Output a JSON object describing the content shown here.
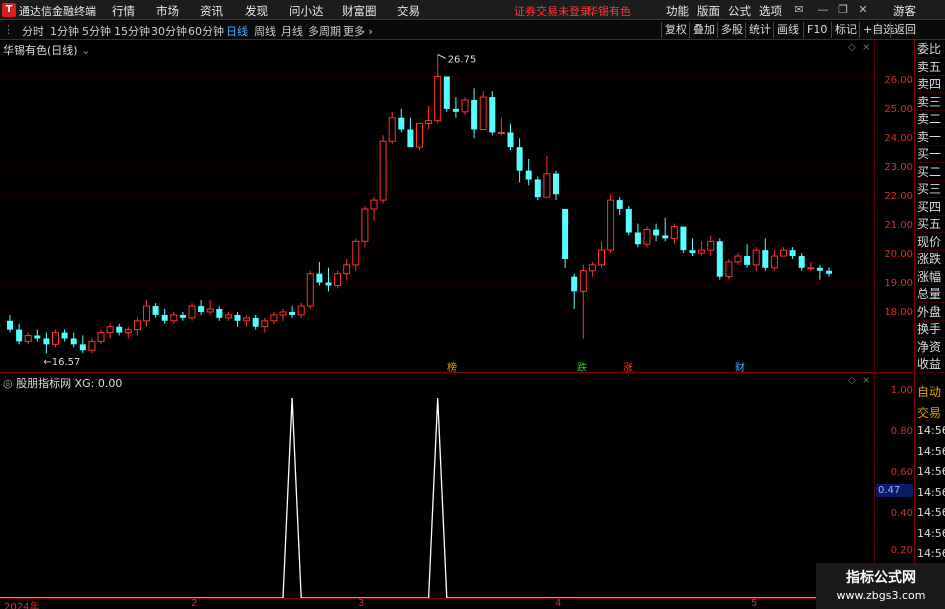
{
  "app": {
    "title": "通达信金融终端",
    "logo": "T"
  },
  "menu": [
    "行情",
    "市场",
    "资讯",
    "发现",
    "问小达",
    "财富圈",
    "交易"
  ],
  "notice": {
    "trade": "证券交易未登录",
    "stock": "华锡有色"
  },
  "right_menu": [
    "功能",
    "版面",
    "公式",
    "选项"
  ],
  "user": "游客",
  "period_tabs": [
    "分时",
    "1分钟",
    "5分钟",
    "15分钟",
    "30分钟",
    "60分钟",
    "日线",
    "周线",
    "月线",
    "多周期",
    "更多"
  ],
  "active_period": "日线",
  "right_buttons": [
    "复权",
    "叠加",
    "多股",
    "统计",
    "画线",
    "F10",
    "标记",
    "+自选",
    "返回"
  ],
  "stock_title": "华锡有色(日线)",
  "indicator_title": "股朋指标网 XG: 0.00",
  "price_axis": [
    "26.00",
    "25.00",
    "24.00",
    "23.00",
    "22.00",
    "21.00",
    "20.00",
    "19.00",
    "18.00"
  ],
  "ind_axis": [
    "1.00",
    "0.80",
    "0.60",
    "0.40",
    "0.20"
  ],
  "xg_current": "0.47",
  "price_high_label": "26.75",
  "price_low_label": "16.57",
  "event_tags": [
    {
      "text": "榜",
      "color": "#e0a000"
    },
    {
      "text": "跌",
      "color": "#22cc22"
    },
    {
      "text": "涨",
      "color": "#ff3333"
    },
    {
      "text": "财",
      "color": "#55aaff"
    }
  ],
  "side_panel": [
    "委比",
    "卖五",
    "卖四",
    "卖三",
    "卖二",
    "卖一",
    "买一",
    "买二",
    "买三",
    "买四",
    "买五",
    "现价",
    "涨跌",
    "涨幅",
    "总量",
    "外盘",
    "换手",
    "净资",
    "收益"
  ],
  "side_lower": [
    "自动",
    "交易",
    "14:56",
    "14:56",
    "14:56",
    "14:56",
    "14:56",
    "14:56",
    "14:56",
    "14:56",
    "14:56",
    "14:56"
  ],
  "x_axis": [
    "2024年",
    "2",
    "3",
    "4",
    "5"
  ],
  "watermark": {
    "line1": "指标公式网",
    "line2": "www.zbgs3.com"
  },
  "colors": {
    "up": "#ff3232",
    "down": "#54ffff",
    "axis": "#cc3333",
    "signal": "#ffffff"
  },
  "chart_data": {
    "type": "candlestick",
    "ylim": [
      16.3,
      26.9
    ],
    "candles": [
      [
        17.7,
        17.9,
        17.3,
        17.4
      ],
      [
        17.4,
        17.6,
        16.9,
        17.0
      ],
      [
        17.0,
        17.3,
        16.9,
        17.2
      ],
      [
        17.2,
        17.4,
        17.0,
        17.1
      ],
      [
        17.1,
        17.3,
        16.6,
        16.9
      ],
      [
        16.9,
        17.4,
        16.8,
        17.3
      ],
      [
        17.3,
        17.4,
        17.0,
        17.1
      ],
      [
        17.1,
        17.3,
        16.8,
        16.9
      ],
      [
        16.9,
        17.2,
        16.6,
        16.7
      ],
      [
        16.7,
        17.1,
        16.6,
        17.0
      ],
      [
        17.0,
        17.4,
        16.9,
        17.3
      ],
      [
        17.3,
        17.6,
        17.1,
        17.5
      ],
      [
        17.5,
        17.6,
        17.2,
        17.3
      ],
      [
        17.3,
        17.5,
        17.1,
        17.4
      ],
      [
        17.4,
        17.8,
        17.2,
        17.7
      ],
      [
        17.7,
        18.4,
        17.5,
        18.2
      ],
      [
        18.2,
        18.3,
        17.8,
        17.9
      ],
      [
        17.9,
        18.1,
        17.6,
        17.7
      ],
      [
        17.7,
        18.0,
        17.6,
        17.9
      ],
      [
        17.9,
        18.0,
        17.7,
        17.8
      ],
      [
        17.8,
        18.3,
        17.7,
        18.2
      ],
      [
        18.2,
        18.4,
        17.9,
        18.0
      ],
      [
        18.0,
        18.4,
        17.9,
        18.1
      ],
      [
        18.1,
        18.2,
        17.7,
        17.8
      ],
      [
        17.8,
        18.0,
        17.7,
        17.9
      ],
      [
        17.9,
        18.0,
        17.5,
        17.7
      ],
      [
        17.7,
        17.9,
        17.5,
        17.8
      ],
      [
        17.8,
        17.9,
        17.4,
        17.5
      ],
      [
        17.5,
        17.8,
        17.3,
        17.7
      ],
      [
        17.7,
        18.0,
        17.6,
        17.9
      ],
      [
        17.9,
        18.1,
        17.7,
        18.0
      ],
      [
        18.0,
        18.2,
        17.8,
        17.9
      ],
      [
        17.9,
        18.3,
        17.8,
        18.2
      ],
      [
        18.2,
        19.4,
        18.1,
        19.3
      ],
      [
        19.3,
        19.7,
        18.9,
        19.0
      ],
      [
        19.0,
        19.5,
        18.7,
        18.9
      ],
      [
        18.9,
        19.4,
        18.8,
        19.3
      ],
      [
        19.3,
        19.8,
        19.1,
        19.6
      ],
      [
        19.6,
        20.5,
        19.4,
        20.4
      ],
      [
        20.4,
        21.6,
        20.2,
        21.5
      ],
      [
        21.5,
        21.9,
        21.1,
        21.8
      ],
      [
        21.8,
        24.0,
        21.7,
        23.8
      ],
      [
        23.8,
        24.8,
        23.7,
        24.6
      ],
      [
        24.6,
        24.9,
        24.1,
        24.2
      ],
      [
        24.2,
        24.6,
        23.6,
        23.6
      ],
      [
        23.6,
        24.4,
        23.5,
        24.4
      ],
      [
        24.4,
        25.0,
        24.2,
        24.5
      ],
      [
        24.5,
        26.75,
        24.4,
        26.0
      ],
      [
        26.0,
        26.0,
        24.8,
        24.9
      ],
      [
        24.9,
        25.3,
        24.6,
        24.8
      ],
      [
        24.8,
        25.3,
        24.7,
        25.2
      ],
      [
        25.2,
        25.6,
        23.9,
        24.2
      ],
      [
        24.2,
        25.5,
        24.2,
        25.3
      ],
      [
        25.3,
        25.5,
        24.0,
        24.1
      ],
      [
        24.1,
        24.6,
        24.0,
        24.1
      ],
      [
        24.1,
        24.4,
        23.5,
        23.6
      ],
      [
        23.6,
        23.9,
        22.4,
        22.8
      ],
      [
        22.8,
        23.2,
        22.3,
        22.5
      ],
      [
        22.5,
        22.6,
        21.8,
        21.9
      ],
      [
        21.9,
        23.3,
        21.9,
        22.7
      ],
      [
        22.7,
        22.8,
        21.8,
        22.0
      ],
      [
        21.5,
        20.5,
        19.5,
        19.8
      ],
      [
        19.2,
        19.3,
        18.1,
        18.7
      ],
      [
        18.7,
        19.6,
        17.1,
        19.4
      ],
      [
        19.4,
        19.7,
        19.2,
        19.6
      ],
      [
        19.6,
        20.4,
        19.5,
        20.1
      ],
      [
        20.1,
        22.0,
        20.0,
        21.8
      ],
      [
        21.8,
        21.9,
        21.3,
        21.5
      ],
      [
        21.5,
        21.6,
        20.6,
        20.7
      ],
      [
        20.7,
        21.0,
        20.2,
        20.3
      ],
      [
        20.3,
        20.9,
        20.2,
        20.8
      ],
      [
        20.8,
        21.0,
        20.4,
        20.6
      ],
      [
        20.6,
        21.2,
        20.4,
        20.5
      ],
      [
        20.5,
        21.0,
        20.3,
        20.9
      ],
      [
        20.9,
        20.9,
        20.0,
        20.1
      ],
      [
        20.1,
        20.5,
        19.9,
        20.0
      ],
      [
        20.0,
        20.4,
        19.9,
        20.1
      ],
      [
        20.1,
        20.6,
        19.9,
        20.4
      ],
      [
        20.4,
        20.5,
        19.1,
        19.2
      ],
      [
        19.2,
        19.8,
        19.1,
        19.7
      ],
      [
        19.7,
        20.0,
        19.6,
        19.9
      ],
      [
        19.9,
        20.3,
        19.5,
        19.6
      ],
      [
        19.6,
        20.2,
        19.4,
        20.1
      ],
      [
        20.1,
        20.5,
        19.4,
        19.5
      ],
      [
        19.5,
        20.1,
        19.4,
        19.9
      ],
      [
        19.9,
        20.2,
        19.9,
        20.1
      ],
      [
        20.1,
        20.2,
        19.8,
        19.9
      ],
      [
        19.9,
        20.0,
        19.4,
        19.5
      ],
      [
        19.5,
        19.7,
        19.4,
        19.5
      ],
      [
        19.5,
        19.6,
        19.1,
        19.4
      ],
      [
        19.4,
        19.5,
        19.2,
        19.3
      ]
    ],
    "xg_signal": {
      "ylim": [
        0,
        1.05
      ],
      "spike_index": [
        31,
        47
      ]
    }
  }
}
